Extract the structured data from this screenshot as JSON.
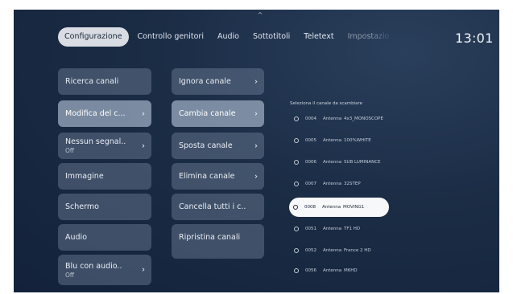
{
  "top_indicator": "^",
  "tabs": [
    {
      "label": "Configurazione",
      "active": true
    },
    {
      "label": "Controllo genitori"
    },
    {
      "label": "Audio"
    },
    {
      "label": "Sottotitoli"
    },
    {
      "label": "Teletext"
    },
    {
      "label": "Impostazio"
    }
  ],
  "clock": "13:01",
  "col1": [
    {
      "label": "Ricerca canali"
    },
    {
      "label": "Modifica del c...",
      "chevron": "›"
    },
    {
      "label": "Nessun segnal..",
      "sub": "Off",
      "chevron": "›"
    },
    {
      "label": "Immagine"
    },
    {
      "label": "Schermo"
    },
    {
      "label": "Audio"
    },
    {
      "label": "Blu con audio..",
      "sub": "Off",
      "chevron": "›"
    }
  ],
  "col2": [
    {
      "label": "Ignora canale",
      "chevron": "›"
    },
    {
      "label": "Cambia canale",
      "chevron": "›"
    },
    {
      "label": "Sposta canale",
      "chevron": "›"
    },
    {
      "label": "Elimina canale",
      "chevron": "›"
    },
    {
      "label": "Cancella tutti i c.."
    },
    {
      "label": "Ripristina canali"
    }
  ],
  "channel_list": {
    "title": "Seleziona il canale da scambiare",
    "channels": [
      {
        "num": "0004",
        "source": "Antenna",
        "name": "4x3_MONOSCOPE"
      },
      {
        "num": "0005",
        "source": "Antenna",
        "name": "100%WHITE"
      },
      {
        "num": "0006",
        "source": "Antenna",
        "name": "SUB LUMINANCE"
      },
      {
        "num": "0007",
        "source": "Antenna",
        "name": "32STEP"
      },
      {
        "num": "0008",
        "source": "Antenna",
        "name": "MOVING1"
      },
      {
        "num": "0051",
        "source": "Antenna",
        "name": "TF1 HD"
      },
      {
        "num": "0052",
        "source": "Antenna",
        "name": "France 2 HD"
      },
      {
        "num": "0056",
        "source": "Antenna",
        "name": "M6HD"
      }
    ]
  }
}
